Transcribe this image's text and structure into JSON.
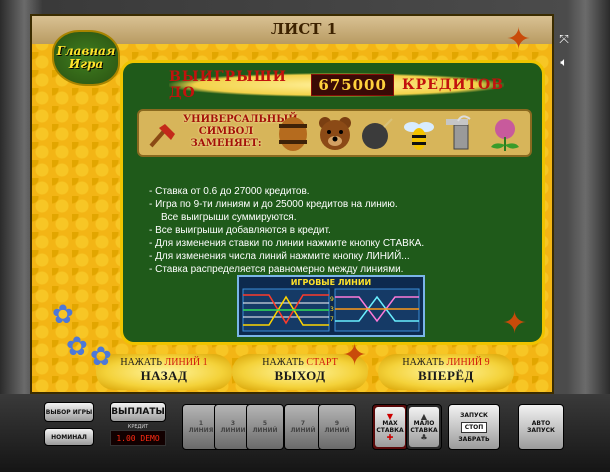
{
  "window": {
    "sheet_label": "ЛИСТ 1",
    "logo_text": "Главная Игра",
    "icons": [
      "resize-icon",
      "sound-icon"
    ]
  },
  "panel": {
    "wins_prefix": "ВЫИГРЫШИ ДО",
    "wins_amount": "675000",
    "wins_suffix": "КРЕДИТОВ",
    "wild_text": "УНИВЕРСАЛЬНЫЙ СИМВОЛ ЗАМЕНЯЕТ:",
    "symbols": [
      "honey-dipper",
      "barrel",
      "bear",
      "cannonball",
      "bee",
      "smoker",
      "clover"
    ],
    "rules": [
      "- Ставка от 0.6 до 27000 кредитов.",
      "- Игра по 9-ти линиям и до 25000 кредитов на линию.",
      "Все выигрыши суммируются.",
      "- Все выигрыши добавляются в кредит.",
      "- Для изменения ставки по линии нажмите кнопку СТАВКА.",
      "- Для изменения числа линий нажмите кнопку ЛИНИЙ...",
      "- Ставка распределяется равномерно между линиями."
    ],
    "lines_title": "ИГРОВЫЕ ЛИНИИ"
  },
  "nav": {
    "back": {
      "hint": "НАЖАТЬ",
      "hint_key": "ЛИНИЙ 1",
      "label": "НАЗАД"
    },
    "exit": {
      "hint": "НАЖАТЬ",
      "hint_key": "СТАРТ",
      "label": "ВЫХОД"
    },
    "forward": {
      "hint": "НАЖАТЬ",
      "hint_key": "ЛИНИЙ 9",
      "label": "ВПЕРЁД"
    }
  },
  "console": {
    "select_game": "ВЫБОР ИГРЫ",
    "nominal": "НОМИНАЛ",
    "payouts": "ВЫПЛАТЫ",
    "credit_label": "КРЕДИТ",
    "credit_value": "1.00 DEMO",
    "line_buttons": [
      {
        "num": "1",
        "label": "ЛИНИЯ"
      },
      {
        "num": "3",
        "label": "ЛИНИИ"
      },
      {
        "num": "5",
        "label": "ЛИНИЙ"
      },
      {
        "num": "7",
        "label": "ЛИНИЙ"
      },
      {
        "num": "9",
        "label": "ЛИНИЙ"
      }
    ],
    "max_bet": "МАХ СТАВКА",
    "min_bet": "МАЛО СТАВКА",
    "start": "ЗАПУСК",
    "stop": "СТОП",
    "take": "ЗАБРАТЬ",
    "auto": "АВТО ЗАПУСК"
  }
}
